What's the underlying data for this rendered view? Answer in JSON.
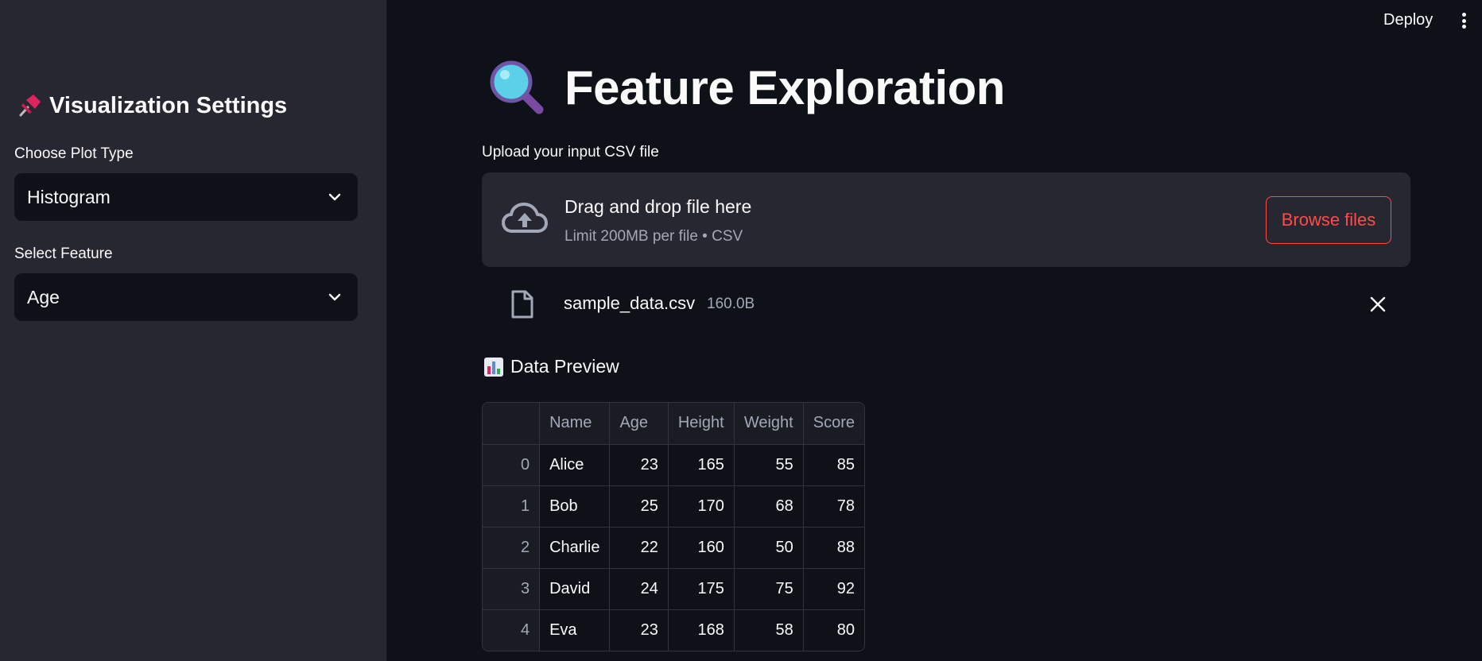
{
  "sidebar": {
    "title": "Visualization Settings",
    "plot_type": {
      "label": "Choose Plot Type",
      "value": "Histogram"
    },
    "feature": {
      "label": "Select Feature",
      "value": "Age"
    }
  },
  "topbar": {
    "deploy_label": "Deploy"
  },
  "main": {
    "title": "Feature Exploration",
    "upload": {
      "label": "Upload your input CSV file",
      "drop_text": "Drag and drop file here",
      "limit_text": "Limit 200MB per file • CSV",
      "browse_label": "Browse files"
    },
    "file": {
      "name": "sample_data.csv",
      "size": "160.0B"
    },
    "preview_title": "Data Preview",
    "table": {
      "columns": [
        "Name",
        "Age",
        "Height",
        "Weight",
        "Score"
      ],
      "rows": [
        {
          "index": "0",
          "cells": [
            "Alice",
            "23",
            "165",
            "55",
            "85"
          ]
        },
        {
          "index": "1",
          "cells": [
            "Bob",
            "25",
            "170",
            "68",
            "78"
          ]
        },
        {
          "index": "2",
          "cells": [
            "Charlie",
            "22",
            "160",
            "50",
            "88"
          ]
        },
        {
          "index": "3",
          "cells": [
            "David",
            "24",
            "175",
            "75",
            "92"
          ]
        },
        {
          "index": "4",
          "cells": [
            "Eva",
            "23",
            "168",
            "58",
            "80"
          ]
        }
      ]
    }
  },
  "colors": {
    "app_background": "#0e1117",
    "sidebar_background": "#262730",
    "accent": "#ff4b4b",
    "muted_text": "#a3a8b8"
  },
  "icons": [
    "pushpin-icon",
    "chevron-down-icon",
    "kebab-menu-icon",
    "magnifying-glass-icon",
    "cloud-upload-icon",
    "file-icon",
    "close-icon",
    "bar-chart-icon"
  ]
}
